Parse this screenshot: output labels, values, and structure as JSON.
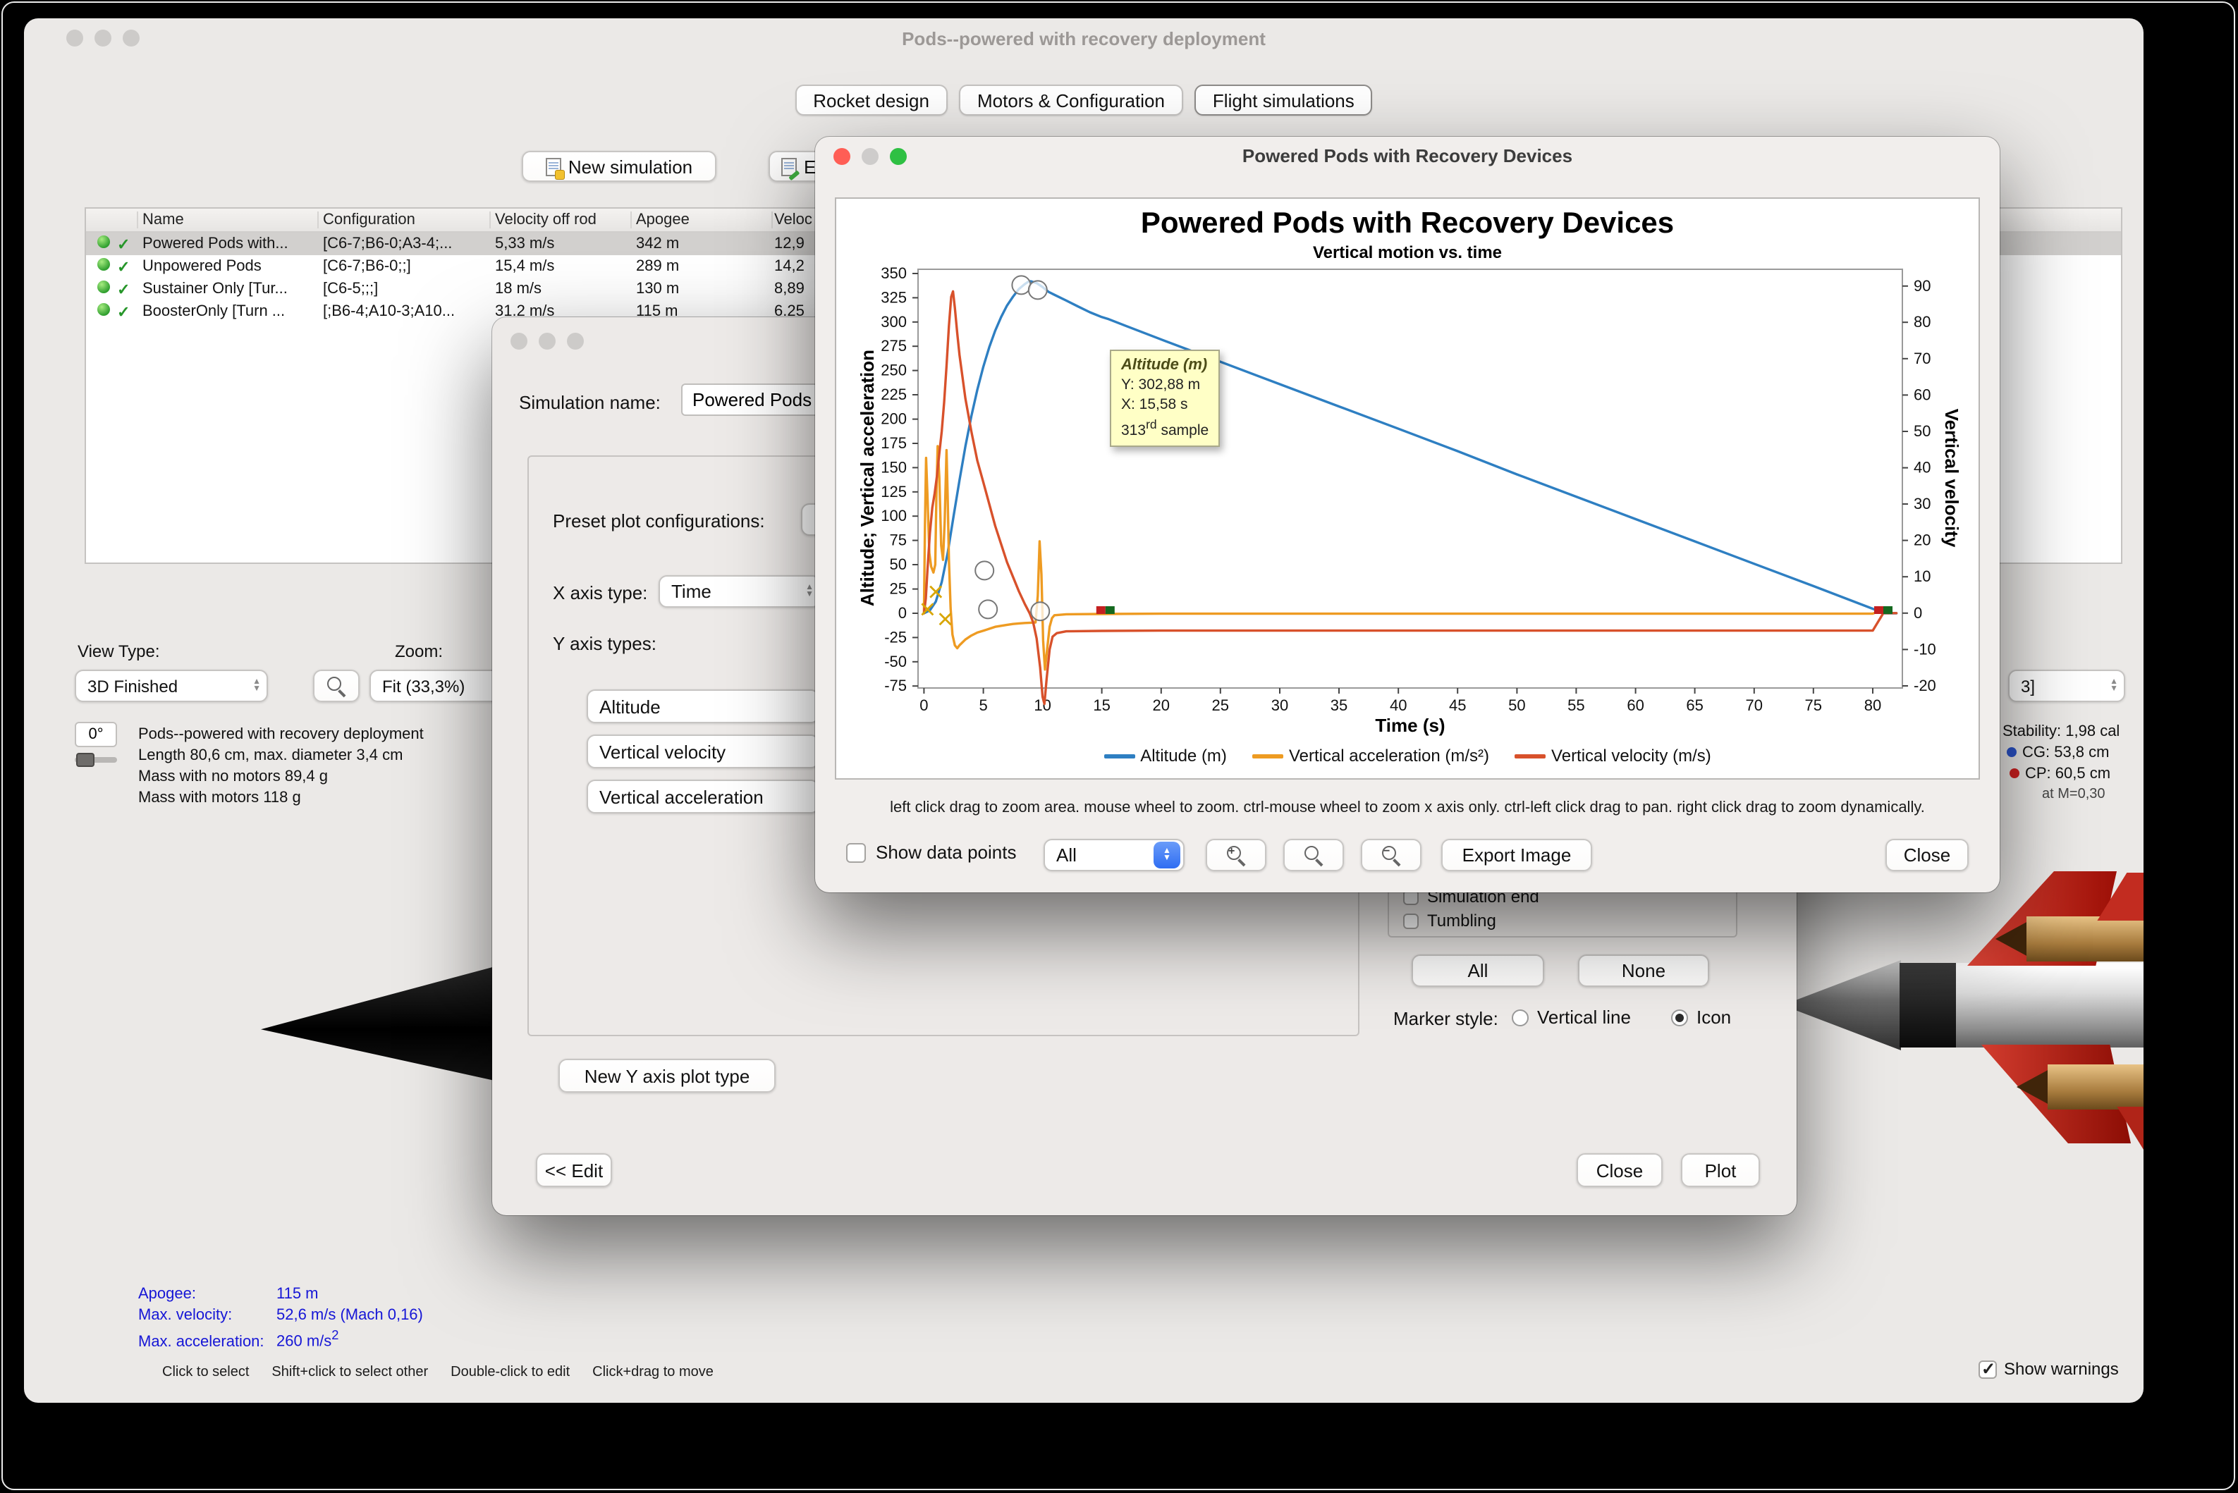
{
  "window": {
    "title": "Pods--powered with recovery deployment",
    "tabs": [
      "Rocket design",
      "Motors & Configuration",
      "Flight simulations"
    ],
    "toolbar": {
      "new_simulation": "New simulation",
      "edit_simulation_partial": "E"
    }
  },
  "sim_table": {
    "columns": [
      "Name",
      "Configuration",
      "Velocity off rod",
      "Apogee",
      "Veloc"
    ],
    "rows": [
      {
        "name": "Powered Pods with...",
        "config": "[C6-7;B6-0;A3-4;...",
        "velocity": "5,33 m/s",
        "apogee": "342 m",
        "velocity2": "12,9"
      },
      {
        "name": "Unpowered Pods",
        "config": "[C6-7;B6-0;;]",
        "velocity": "15,4 m/s",
        "apogee": "289 m",
        "velocity2": "14,2"
      },
      {
        "name": "Sustainer Only [Tur...",
        "config": "[C6-5;;;]",
        "velocity": "18 m/s",
        "apogee": "130 m",
        "velocity2": "8,89"
      },
      {
        "name": "BoosterOnly [Turn ...",
        "config": "[;B6-4;A10-3;A10...",
        "velocity": "31.2 m/s",
        "apogee": "115 m",
        "velocity2": "6.25"
      }
    ]
  },
  "view_panel": {
    "view_type_label": "View Type:",
    "view_type_value": "3D Finished",
    "zoom_label": "Zoom:",
    "zoom_value": "Fit (33,3%)",
    "angle_value": "0°",
    "rocket_info": [
      "Pods--powered with recovery deployment",
      "Length 80,6 cm, max. diameter 3,4 cm",
      "Mass with no motors 89,4 g",
      "Mass with motors 118 g"
    ],
    "stats": [
      {
        "label": "Apogee:",
        "value": "115 m"
      },
      {
        "label": "Max. velocity:",
        "value": "52,6 m/s (Mach 0,16)"
      },
      {
        "label": "Max. acceleration:",
        "value": "260 m/s",
        "sup": "2"
      }
    ],
    "hints": [
      "Click to select",
      "Shift+click to select other",
      "Double-click to edit",
      "Click+drag to move"
    ],
    "show_warnings_label": "Show warnings",
    "config_select_value": "3]",
    "stability": "Stability: 1,98 cal",
    "cg": "CG: 53,8 cm",
    "cp": "CP: 60,5 cm",
    "mach_note": "at M=0,30"
  },
  "edit_dialog": {
    "sim_name_label": "Simulation name:",
    "sim_name_value": "Powered Pods w",
    "preset_label": "Preset plot configurations:",
    "x_axis_label": "X axis type:",
    "x_axis_value": "Time",
    "y_axis_label": "Y axis types:",
    "y_axis_types": [
      "Altitude",
      "Vertical velocity",
      "Vertical acceleration"
    ],
    "new_y_axis_button": "New Y axis plot type",
    "edit_button": "<< Edit",
    "close_button": "Close",
    "plot_button": "Plot",
    "event_items": [
      "Simulation end",
      "Tumbling"
    ],
    "all_button": "All",
    "none_button": "None",
    "marker_style_label": "Marker style:",
    "marker_vertical_line": "Vertical line",
    "marker_icon": "Icon"
  },
  "plot_dialog": {
    "title": "Powered Pods with Recovery Devices",
    "help_text": "left click drag to zoom area. mouse wheel to zoom. ctrl-mouse wheel to zoom x axis only. ctrl-left click drag to pan.  right click drag to zoom dynamically.",
    "show_data_points_label": "Show data points",
    "series_select_value": "All",
    "export_button": "Export Image",
    "close_button": "Close",
    "tooltip": {
      "series": "Altitude (m)",
      "y": "Y: 302,88 m",
      "x": "X: 15,58 s",
      "sample_num": "313",
      "sample_ord": "rd",
      "sample_word": "sample"
    }
  },
  "chart_data": {
    "type": "line",
    "title": "Powered Pods with Recovery Devices",
    "subtitle": "Vertical motion vs. time",
    "xlabel": "Time (s)",
    "ylabel_left": "Altitude; Vertical acceleration",
    "ylabel_right": "Vertical velocity",
    "xlim": [
      -0.5,
      82.5
    ],
    "ylim_left": [
      -77,
      354.3
    ],
    "ylim_right": [
      -20.6,
      94.6
    ],
    "xticks": [
      0,
      5,
      10,
      15,
      20,
      25,
      30,
      35,
      40,
      45,
      50,
      55,
      60,
      65,
      70,
      75,
      80
    ],
    "yticks_left": [
      -75,
      -50,
      -25,
      0,
      25,
      50,
      75,
      100,
      125,
      150,
      175,
      200,
      225,
      250,
      275,
      300,
      325,
      350
    ],
    "yticks_right": [
      -20,
      -10,
      0,
      10,
      20,
      30,
      40,
      50,
      60,
      70,
      80,
      90
    ],
    "grid": false,
    "legend_position": "bottom",
    "series": [
      {
        "name": "Altitude (m)",
        "axis": "left",
        "color": "#2e7fc2",
        "points": [
          [
            0,
            0
          ],
          [
            0.5,
            3
          ],
          [
            1,
            12
          ],
          [
            1.5,
            32
          ],
          [
            2,
            62
          ],
          [
            2.5,
            100
          ],
          [
            3,
            137
          ],
          [
            3.5,
            172
          ],
          [
            4,
            203
          ],
          [
            4.5,
            230
          ],
          [
            5,
            254
          ],
          [
            5.5,
            274
          ],
          [
            6,
            291
          ],
          [
            6.5,
            305
          ],
          [
            7,
            317
          ],
          [
            7.5,
            326
          ],
          [
            8,
            334
          ],
          [
            8.5,
            339
          ],
          [
            8.8,
            341.5
          ],
          [
            9,
            342
          ],
          [
            9.5,
            340
          ],
          [
            10,
            336
          ],
          [
            10.5,
            331
          ],
          [
            11,
            328
          ],
          [
            12,
            322
          ],
          [
            13,
            316
          ],
          [
            14,
            310
          ],
          [
            15,
            305
          ],
          [
            15.58,
            302.88
          ],
          [
            17,
            296
          ],
          [
            20,
            282
          ],
          [
            25,
            259
          ],
          [
            30,
            236
          ],
          [
            35,
            213
          ],
          [
            40,
            190
          ],
          [
            45,
            167
          ],
          [
            50,
            143
          ],
          [
            55,
            120
          ],
          [
            60,
            97
          ],
          [
            65,
            74
          ],
          [
            70,
            51
          ],
          [
            75,
            28
          ],
          [
            80,
            4.6
          ],
          [
            80.9,
            0
          ],
          [
            82,
            0
          ]
        ]
      },
      {
        "name": "Vertical acceleration (m/s²)",
        "axis": "left",
        "color": "#ee9b22",
        "points": [
          [
            0,
            0
          ],
          [
            0.08,
            90
          ],
          [
            0.18,
            160
          ],
          [
            0.3,
            120
          ],
          [
            0.45,
            62
          ],
          [
            0.6,
            48
          ],
          [
            0.8,
            42
          ],
          [
            0.95,
            50
          ],
          [
            1.05,
            120
          ],
          [
            1.15,
            172
          ],
          [
            1.3,
            140
          ],
          [
            1.45,
            70
          ],
          [
            1.6,
            55
          ],
          [
            1.75,
            95
          ],
          [
            1.9,
            168
          ],
          [
            2,
            120
          ],
          [
            2.1,
            55
          ],
          [
            2.25,
            5
          ],
          [
            2.4,
            -22
          ],
          [
            2.6,
            -33
          ],
          [
            2.8,
            -36
          ],
          [
            3,
            -33
          ],
          [
            3.5,
            -27
          ],
          [
            4,
            -23
          ],
          [
            4.5,
            -20
          ],
          [
            5,
            -18
          ],
          [
            5.5,
            -16
          ],
          [
            6,
            -14
          ],
          [
            6.5,
            -13
          ],
          [
            7,
            -12
          ],
          [
            7.5,
            -11
          ],
          [
            8,
            -10.5
          ],
          [
            8.5,
            -10
          ],
          [
            9,
            -9.8
          ],
          [
            9.4,
            -9.5
          ],
          [
            9.6,
            18
          ],
          [
            9.75,
            74
          ],
          [
            9.9,
            40
          ],
          [
            10.05,
            -28
          ],
          [
            10.2,
            -58
          ],
          [
            10.4,
            -35
          ],
          [
            10.6,
            -14
          ],
          [
            10.8,
            -5
          ],
          [
            11,
            -2
          ],
          [
            12,
            -1
          ],
          [
            15,
            -0.7
          ],
          [
            20,
            -0.5
          ],
          [
            30,
            -0.5
          ],
          [
            40,
            -0.5
          ],
          [
            50,
            -0.5
          ],
          [
            60,
            -0.5
          ],
          [
            70,
            -0.5
          ],
          [
            80,
            -0.5
          ],
          [
            80.9,
            4
          ],
          [
            81.3,
            0
          ]
        ]
      },
      {
        "name": "Vertical velocity (m/s)",
        "axis": "right",
        "color": "#d8512b",
        "points": [
          [
            0,
            0
          ],
          [
            0.15,
            4
          ],
          [
            0.3,
            12
          ],
          [
            0.5,
            22
          ],
          [
            0.7,
            29
          ],
          [
            0.9,
            33
          ],
          [
            1.1,
            38
          ],
          [
            1.3,
            44
          ],
          [
            1.5,
            50
          ],
          [
            1.7,
            58
          ],
          [
            1.9,
            68
          ],
          [
            2.1,
            79
          ],
          [
            2.3,
            87
          ],
          [
            2.45,
            88.5
          ],
          [
            2.6,
            84
          ],
          [
            2.8,
            77
          ],
          [
            3,
            71
          ],
          [
            3.5,
            59
          ],
          [
            4,
            50
          ],
          [
            4.5,
            42
          ],
          [
            5,
            36
          ],
          [
            5.5,
            30
          ],
          [
            6,
            24
          ],
          [
            6.5,
            19
          ],
          [
            7,
            14
          ],
          [
            7.5,
            10
          ],
          [
            8,
            6
          ],
          [
            8.5,
            2.5
          ],
          [
            8.9,
            0
          ],
          [
            9.2,
            -2.5
          ],
          [
            9.5,
            -7
          ],
          [
            9.8,
            -15
          ],
          [
            10,
            -23
          ],
          [
            10.15,
            -25
          ],
          [
            10.35,
            -18
          ],
          [
            10.6,
            -10
          ],
          [
            10.85,
            -6.5
          ],
          [
            11.2,
            -5.5
          ],
          [
            12,
            -5
          ],
          [
            15,
            -4.9
          ],
          [
            20,
            -4.8
          ],
          [
            30,
            -4.8
          ],
          [
            40,
            -4.8
          ],
          [
            50,
            -4.8
          ],
          [
            60,
            -4.8
          ],
          [
            70,
            -4.8
          ],
          [
            80,
            -4.8
          ],
          [
            80.9,
            0
          ],
          [
            82,
            0
          ]
        ]
      }
    ],
    "markers": [
      {
        "t": 8.2,
        "v": 338,
        "kind": "circle"
      },
      {
        "t": 9.6,
        "v": 333,
        "kind": "circle"
      },
      {
        "t": 5.1,
        "v": 44,
        "kind": "circle"
      },
      {
        "t": 5.4,
        "v": 4,
        "kind": "circle"
      },
      {
        "t": 9.8,
        "v": 2,
        "kind": "circle"
      },
      {
        "t": 0.3,
        "v": 4,
        "kind": "cross"
      },
      {
        "t": 1.0,
        "v": 22,
        "kind": "cross"
      },
      {
        "t": 1.8,
        "v": -6,
        "kind": "cross"
      }
    ],
    "flags": [
      {
        "t": 15.3
      },
      {
        "t": 80.9
      }
    ]
  }
}
